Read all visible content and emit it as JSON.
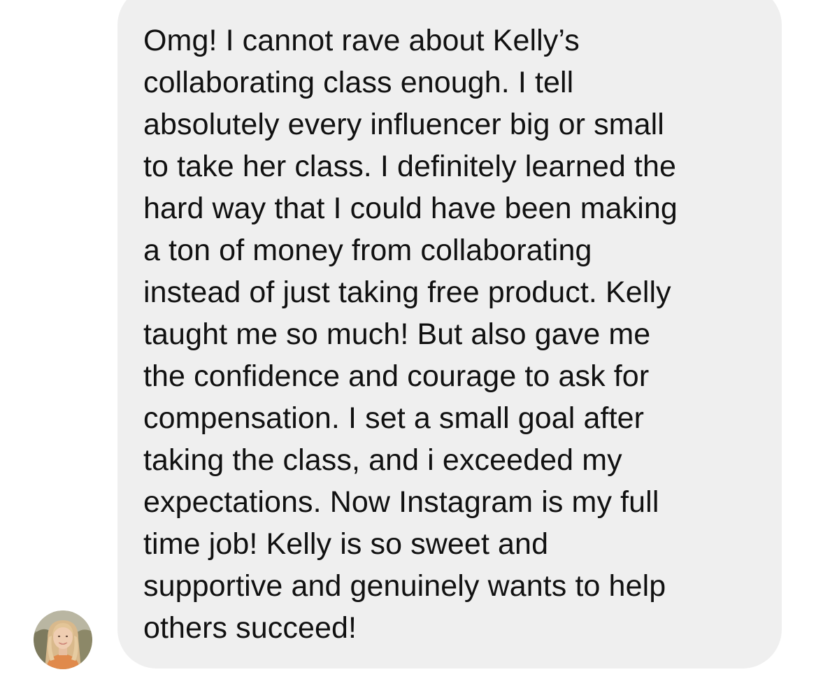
{
  "message": {
    "lines": [
      "Omg! I cannot rave about Kelly’s",
      "collaborating class enough. I tell",
      "absolutely every influencer big or small",
      "to take her class. I definitely learned the",
      "hard way that I could have been making",
      "a ton of money from collaborating",
      "instead of just taking free product. Kelly",
      "taught me so much! But also gave me",
      "the confidence and courage to ask for",
      "compensation. I set a small goal after",
      "taking the class, and i exceeded my",
      "expectations. Now Instagram is my full",
      "time job! Kelly is so sweet and",
      "supportive and genuinely wants to help",
      "others succeed!"
    ]
  },
  "colors": {
    "bubble_background": "#efefef",
    "text": "#111111",
    "page_background": "#ffffff"
  },
  "sender": {
    "avatar_icon": "profile-photo-avatar"
  }
}
